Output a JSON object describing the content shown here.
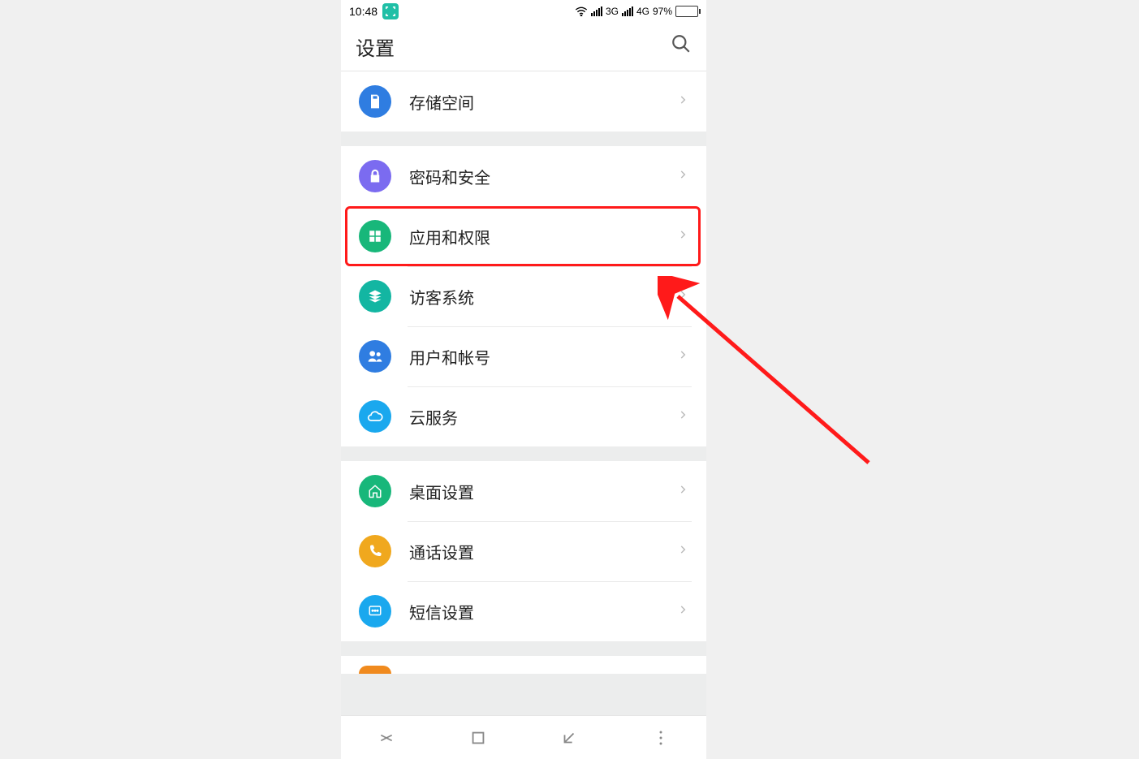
{
  "status": {
    "time": "10:48",
    "net3g": "3G",
    "net4g": "4G",
    "battery_pct": "97%"
  },
  "header": {
    "title": "设置"
  },
  "groups": [
    {
      "rows": [
        {
          "id": "storage",
          "label": "存储空间",
          "icon_color": "#2f7de1",
          "icon": "sd"
        }
      ]
    },
    {
      "rows": [
        {
          "id": "security",
          "label": "密码和安全",
          "icon_color": "#7b6bf0",
          "icon": "lock"
        },
        {
          "id": "apps-perms",
          "label": "应用和权限",
          "icon_color": "#18b77a",
          "icon": "grid",
          "highlighted": true
        },
        {
          "id": "guest",
          "label": "访客系统",
          "icon_color": "#13b6a2",
          "icon": "layers"
        },
        {
          "id": "users",
          "label": "用户和帐号",
          "icon_color": "#2f7de1",
          "icon": "people"
        },
        {
          "id": "cloud",
          "label": "云服务",
          "icon_color": "#1aa8ee",
          "icon": "cloud"
        }
      ]
    },
    {
      "rows": [
        {
          "id": "desktop",
          "label": "桌面设置",
          "icon_color": "#18b77a",
          "icon": "home"
        },
        {
          "id": "call",
          "label": "通话设置",
          "icon_color": "#f0a81e",
          "icon": "phone"
        },
        {
          "id": "sms",
          "label": "短信设置",
          "icon_color": "#1aa8ee",
          "icon": "sms"
        }
      ]
    },
    {
      "partial": true,
      "rows": [
        {
          "id": "next-partial",
          "label": "",
          "icon_color": "#f08a1e",
          "icon": ""
        }
      ]
    }
  ],
  "annotations": {
    "arrow_from": "right-side",
    "arrow_to": "apps-perms-row"
  }
}
